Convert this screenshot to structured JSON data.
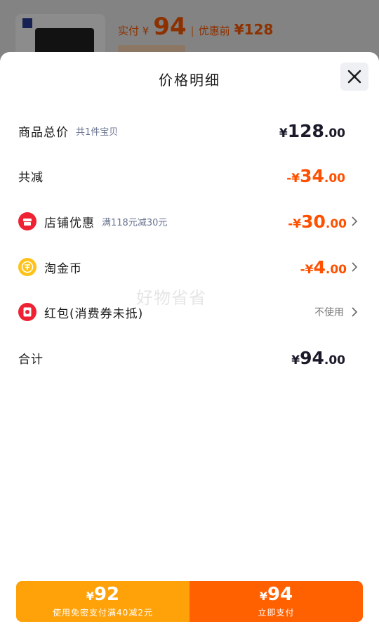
{
  "background": {
    "price_label": "实付 ¥",
    "price_value": "94",
    "separator": "|",
    "original_label": "优惠前",
    "original_price": "¥128"
  },
  "sheet": {
    "title": "价格明细",
    "close_icon": "close-icon"
  },
  "rows": {
    "total": {
      "label": "商品总价",
      "sub": "共1件宝贝",
      "currency": "¥",
      "int": "128",
      "dec": ".00"
    },
    "reduce": {
      "label": "共减",
      "currency": "-¥",
      "int": "34",
      "dec": ".00"
    },
    "store": {
      "label": "店铺优惠",
      "sub": "满118元减30元",
      "currency": "-¥",
      "int": "30",
      "dec": ".00",
      "icon": "store-icon"
    },
    "coin": {
      "label": "淘金币",
      "currency": "-¥",
      "int": "4",
      "dec": ".00",
      "icon": "coin-icon"
    },
    "redpacket": {
      "label": "红包(消费券未抵)",
      "status": "不使用",
      "icon": "red-packet-icon"
    },
    "sum": {
      "label": "合计",
      "currency": "¥",
      "int": "94",
      "dec": ".00"
    }
  },
  "watermark": "好物省省",
  "buttons": {
    "left": {
      "currency": "¥",
      "price": "92",
      "sub": "使用免密支付满40减2元"
    },
    "right": {
      "currency": "¥",
      "price": "94",
      "sub": "立即支付"
    }
  },
  "colors": {
    "accent_orange": "#ff5000",
    "button_left": "#ffa20a",
    "button_right": "#ff6000"
  }
}
